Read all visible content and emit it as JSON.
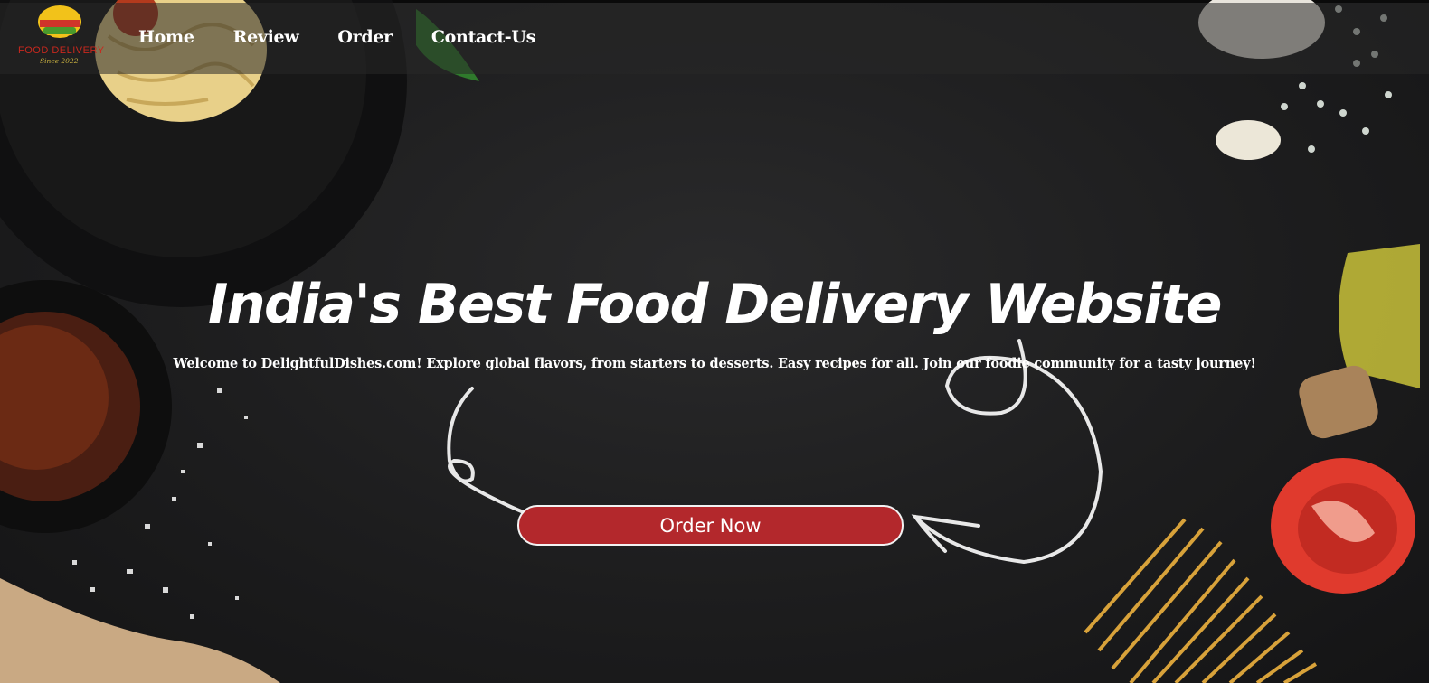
{
  "brand": {
    "logo_text": "FOOD DELIVERY",
    "logo_sub": "Since 2022"
  },
  "nav": {
    "items": [
      {
        "label": "Home"
      },
      {
        "label": "Review"
      },
      {
        "label": "Order"
      },
      {
        "label": "Contact-Us"
      }
    ]
  },
  "hero": {
    "title": "India's Best Food Delivery Website",
    "subtitle": "Welcome to DelightfulDishes.com! Explore global flavors, from starters to desserts. Easy recipes for all. Join our foodie community for a tasty journey!",
    "cta_label": "Order Now"
  },
  "colors": {
    "background": "#1c1c1d",
    "accent": "#b3282c",
    "text": "#ffffff"
  }
}
